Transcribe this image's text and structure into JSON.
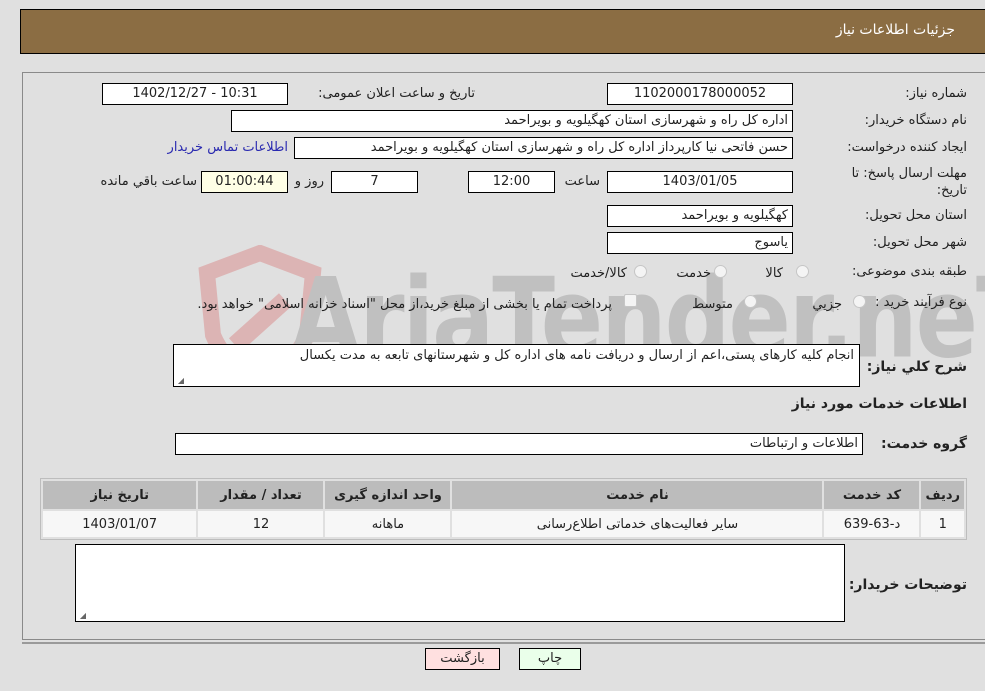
{
  "header": {
    "title": "جزئیات اطلاعات نیاز"
  },
  "fields": {
    "need_number_label": "شماره نیاز:",
    "need_number": "1102000178000052",
    "announce_label": "تاریخ و ساعت اعلان عمومی:",
    "announce_value": "1402/12/27 - 10:31",
    "buyer_org_label": "نام دستگاه خریدار:",
    "buyer_org": "اداره کل راه و شهرسازی استان کهگیلویه و بویراحمد",
    "creator_label": "ایجاد کننده درخواست:",
    "creator": "حسن فاتحی نیا کارپرداز اداره کل راه و شهرسازی استان کهگیلویه و بویراحمد",
    "buyer_contact_link": "اطلاعات تماس خریدار",
    "deadline_label": "مهلت ارسال پاسخ: تا تاریخ:",
    "deadline_date": "1403/01/05",
    "time_label": "ساعت",
    "deadline_time": "12:00",
    "days_value": "7",
    "days_label": "روز و",
    "remaining_time": "01:00:44",
    "remaining_label": "ساعت باقي مانده",
    "province_label": "استان محل تحویل:",
    "province": "کهگیلویه و بویراحمد",
    "city_label": "شهر محل تحویل:",
    "city": "یاسوج",
    "category_label": "طبقه بندی موضوعی:",
    "category_options": [
      "کالا",
      "خدمت",
      "کالا/خدمت"
    ],
    "process_label": "نوع فرآیند خرید :",
    "process_options": [
      "جزیي",
      "متوسط"
    ],
    "payment_note": "پرداخت تمام یا بخشی از مبلغ خرید،از محل \"اسناد خزانه اسلامی\" خواهد بود."
  },
  "description": {
    "label": "شرح کلي نیاز:",
    "value": "انجام کلیه کارهای پستی،اعم از ارسال و دریافت نامه های اداره کل و شهرستانهای تابعه به مدت یکسال"
  },
  "services_section": {
    "title": "اطلاعات خدمات مورد نیاز",
    "group_label": "گروه خدمت:",
    "group_value": "اطلاعات و ارتباطات"
  },
  "table": {
    "headers": [
      "ردیف",
      "کد خدمت",
      "نام خدمت",
      "واحد اندازه گیری",
      "تعداد / مقدار",
      "تاریخ نیاز"
    ],
    "rows": [
      [
        "1",
        "د-63-639",
        "سایر فعالیت‌های خدماتی اطلاع‌رسانی",
        "ماهانه",
        "12",
        "1403/01/07"
      ]
    ]
  },
  "buyer_notes": {
    "label": "توضیحات خریدار:",
    "value": ""
  },
  "buttons": {
    "print": "چاپ",
    "back": "بازگشت"
  },
  "watermark": {
    "text": "AriaTender.neT"
  }
}
